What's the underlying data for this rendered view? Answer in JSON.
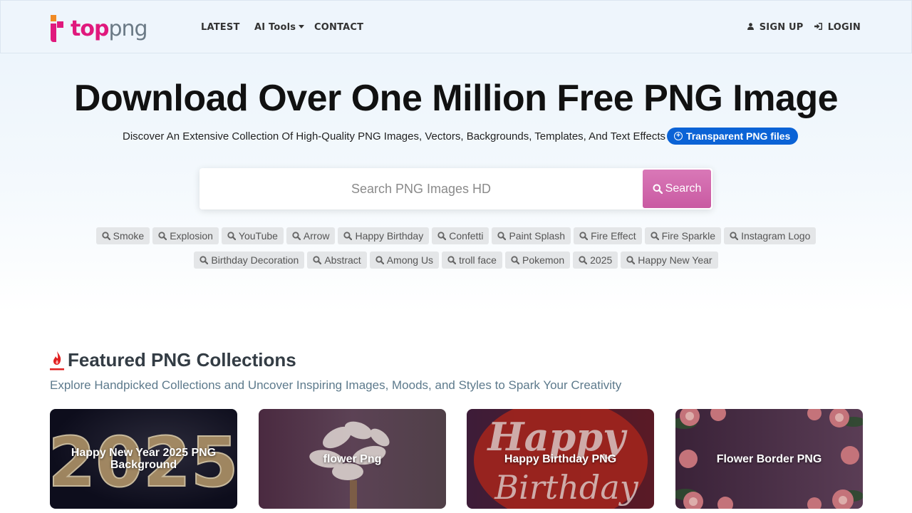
{
  "brand": {
    "logo_top": "top",
    "logo_png": "png"
  },
  "nav": {
    "latest": "LATEST",
    "ai_tools": "AI Tools",
    "contact": "CONTACT",
    "sign_up": "SIGN UP",
    "login": "LOGIN"
  },
  "hero": {
    "title": "Download Over One Million Free PNG Image",
    "subtitle": "Discover An Extensive Collection Of High-Quality PNG Images, Vectors, Backgrounds, Templates, And Text Effects",
    "pill": "Transparent PNG files"
  },
  "search": {
    "placeholder": "Search PNG Images HD",
    "button": "Search"
  },
  "tags_row1": [
    "Smoke",
    "Explosion",
    "YouTube",
    "Arrow",
    "Happy Birthday",
    "Confetti",
    "Paint Splash",
    "Fire Effect",
    "Fire Sparkle",
    "Instagram Logo"
  ],
  "tags_row2": [
    "Birthday Decoration",
    "Abstract",
    "Among Us",
    "troll face",
    "Pokemon",
    "2025",
    "Happy New Year"
  ],
  "featured": {
    "title": "Featured PNG Collections",
    "description": "Explore Handpicked Collections and Uncover Inspiring Images, Moods, and Styles to Spark Your Creativity",
    "cards": [
      {
        "label": "Happy New Year 2025 PNG Background",
        "image_text": "2025"
      },
      {
        "label": "flower Png"
      },
      {
        "label": "Happy Birthday PNG",
        "image_text_1": "Happy",
        "image_text_2": "Birthday"
      },
      {
        "label": "Flower Border PNG"
      }
    ]
  },
  "colors": {
    "brand_pink": "#e0197d",
    "brand_orange": "#f08a24",
    "pill_blue": "#0b63d6",
    "search_button": "#d16aaf",
    "tag_bg": "#e4e6e8"
  }
}
